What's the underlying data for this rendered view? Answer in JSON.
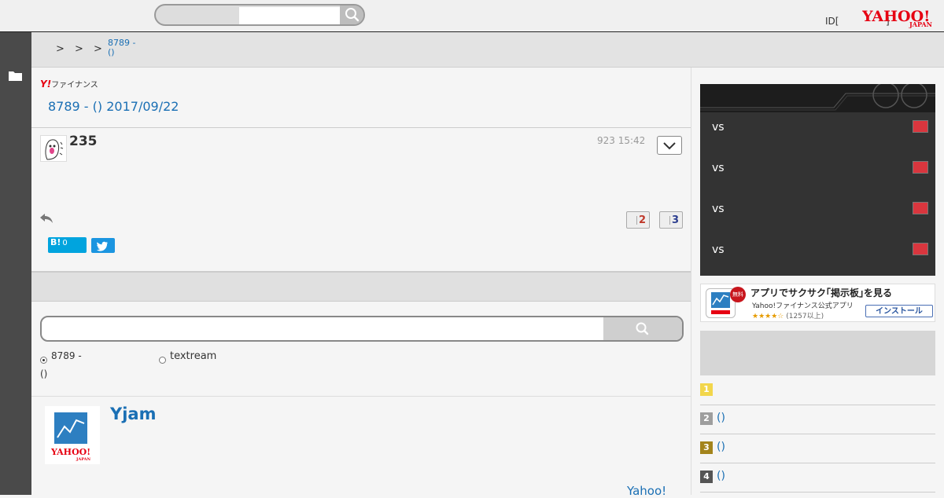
{
  "header": {
    "search_placeholder": "",
    "id_link": "ID[",
    "id_bracket_right": "]",
    "logo_text": "YAHOO!",
    "logo_sub": "JAPAN"
  },
  "breadcrumb": {
    "separators": [
      ">",
      ">",
      ">"
    ],
    "current_line1": "8789 -",
    "current_line2": "()"
  },
  "board": {
    "finance_logo_y": "Y!",
    "finance_logo_text": "ファイナンス",
    "title": "8789 -  () 2017/09/22"
  },
  "post": {
    "number": "235",
    "date": "923 15:42",
    "likes": "2",
    "dislikes": "3",
    "hatena_label": "B!",
    "hatena_count": "0"
  },
  "board_search": {
    "placeholder": "",
    "option_board_line1": "8789 -",
    "option_board_line2": "()",
    "option_textream": "textream"
  },
  "yjam": {
    "title": "Yjam",
    "link": "Yahoo!"
  },
  "sports": {
    "matches": [
      {
        "vs": "vs"
      },
      {
        "vs": "vs"
      },
      {
        "vs": "vs"
      },
      {
        "vs": "vs"
      }
    ]
  },
  "app_ad": {
    "title": "アプリでサクサク｢掲示板｣を見る",
    "subtitle": "Yahoo!ファイナンス公式アプリ",
    "stars": "★★★★☆",
    "reviews": "(1257以上)",
    "free_badge": "無料",
    "install": "インストール"
  },
  "ranking": {
    "items": [
      {
        "rank": "1",
        "label": "",
        "color": "#f2d64b"
      },
      {
        "rank": "2",
        "label": "()",
        "color": "#9e9e9e"
      },
      {
        "rank": "3",
        "label": "()",
        "color": "#a3841c"
      },
      {
        "rank": "4",
        "label": "()",
        "color": "#555555"
      }
    ]
  },
  "colors": {
    "link": "#1a6fb4",
    "yahoo_red": "#e60012",
    "left_rail": "#4a4a4a"
  }
}
